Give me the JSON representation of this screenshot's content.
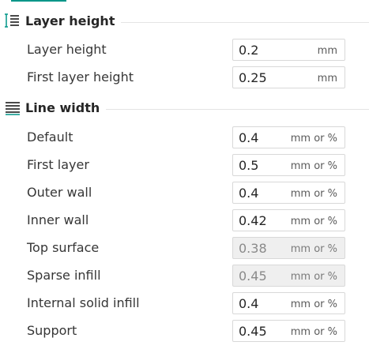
{
  "sections": [
    {
      "title": "Layer height",
      "icon": "layer-height-icon",
      "rows": [
        {
          "label": "Layer height",
          "value": "0.2",
          "unit": "mm",
          "editable": true
        },
        {
          "label": "First layer height",
          "value": "0.25",
          "unit": "mm",
          "editable": true
        }
      ]
    },
    {
      "title": "Line width",
      "icon": "line-width-icon",
      "rows": [
        {
          "label": "Default",
          "value": "0.4",
          "unit": "mm or %",
          "editable": true
        },
        {
          "label": "First layer",
          "value": "0.5",
          "unit": "mm or %",
          "editable": true
        },
        {
          "label": "Outer wall",
          "value": "0.4",
          "unit": "mm or %",
          "editable": true
        },
        {
          "label": "Inner wall",
          "value": "0.42",
          "unit": "mm or %",
          "editable": true
        },
        {
          "label": "Top surface",
          "value": "0.38",
          "unit": "mm or %",
          "editable": false
        },
        {
          "label": "Sparse infill",
          "value": "0.45",
          "unit": "mm or %",
          "editable": false
        },
        {
          "label": "Internal solid infill",
          "value": "0.4",
          "unit": "mm or %",
          "editable": true
        },
        {
          "label": "Support",
          "value": "0.45",
          "unit": "mm or %",
          "editable": true
        }
      ]
    }
  ],
  "colors": {
    "accent": "#009688",
    "icon": "#4a4a4a",
    "disabled_field_bg": "#efefef"
  }
}
